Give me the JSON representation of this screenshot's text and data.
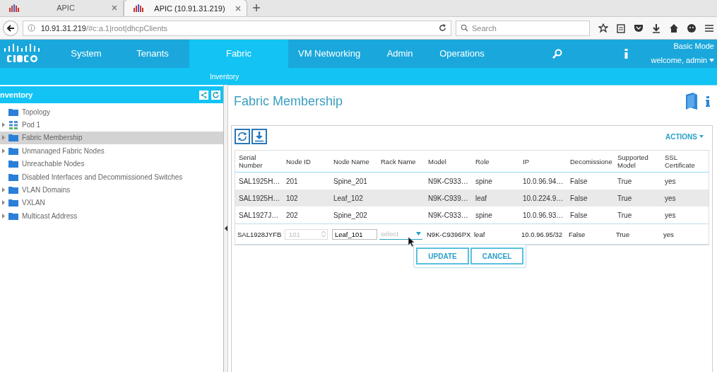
{
  "browser_tabs": [
    {
      "title": "APIC",
      "selected": false
    },
    {
      "title": "APIC (10.91.31.219)",
      "selected": true
    }
  ],
  "address_bar": {
    "url": "**10.91.31.219**/#c:a.1|root|dhcpClients",
    "search_placeholder": "Search"
  },
  "nav": {
    "items": [
      {
        "label": "System",
        "selected": false
      },
      {
        "label": "Tenants",
        "selected": false
      },
      {
        "label": "Fabric",
        "selected": true
      },
      {
        "label": "VM Networking",
        "selected": false
      },
      {
        "label": "Admin",
        "selected": false
      },
      {
        "label": "Operations",
        "selected": false
      }
    ],
    "mode": "Basic Mode",
    "user": "welcome, admin",
    "subnav": [
      "Inventory"
    ]
  },
  "sidebar": {
    "title": "nventory",
    "items": [
      {
        "label": "Topology",
        "kind": "folder",
        "expandable": false,
        "selected": false
      },
      {
        "label": "Pod 1",
        "kind": "pod",
        "expandable": true,
        "selected": false
      },
      {
        "label": "Fabric Membership",
        "kind": "folder",
        "expandable": true,
        "selected": true
      },
      {
        "label": "Unmanaged Fabric Nodes",
        "kind": "folder",
        "expandable": true,
        "selected": false
      },
      {
        "label": "Unreachable Nodes",
        "kind": "folder",
        "expandable": false,
        "selected": false
      },
      {
        "label": "Disabled Interfaces and Decommissioned Switches",
        "kind": "folder",
        "expandable": false,
        "selected": false
      },
      {
        "label": "VLAN Domains",
        "kind": "folder",
        "expandable": true,
        "selected": false
      },
      {
        "label": "VXLAN",
        "kind": "folder",
        "expandable": true,
        "selected": false
      },
      {
        "label": "Multicast Address",
        "kind": "folder",
        "expandable": true,
        "selected": false
      }
    ]
  },
  "content": {
    "title": "Fabric Membership",
    "actions": "ACTIONS",
    "table": {
      "columns": [
        "Serial Number",
        "Node ID",
        "Node Name",
        "Rack Name",
        "Model",
        "Role",
        "IP",
        "Decomissione",
        "Supported Model",
        "SSL Certificate"
      ],
      "rows": [
        {
          "serial": "SAL1925H…",
          "node_id": "201",
          "node_name": "Spine_201",
          "model": "N9K-C933…",
          "role": "spine",
          "ip": "10.0.96.94…",
          "decomissioned": "False",
          "supported": "True",
          "ssl": "yes",
          "shaded": false
        },
        {
          "serial": "SAL1925H…",
          "node_id": "102",
          "node_name": "Leaf_102",
          "model": "N9K-C939…",
          "role": "leaf",
          "ip": "10.0.224.9…",
          "decomissioned": "False",
          "supported": "True",
          "ssl": "yes",
          "shaded": true
        },
        {
          "serial": "SAL1927J…",
          "node_id": "202",
          "node_name": "Spine_202",
          "model": "N9K-C933…",
          "role": "spine",
          "ip": "10.0.96.93…",
          "decomissioned": "False",
          "supported": "True",
          "ssl": "yes",
          "shaded": false
        }
      ],
      "edit_row": {
        "serial": "SAL1928JYFB",
        "node_id": "101",
        "node_id_disabled": true,
        "node_name": "Leaf_101",
        "rack_placeholder": "select",
        "model": "N9K-C9396PX",
        "role": "leaf",
        "ip": "10.0.96.95/32",
        "decomissioned": "False",
        "supported": "True",
        "ssl": "yes"
      },
      "buttons": [
        "UPDATE",
        "CANCEL"
      ]
    }
  }
}
